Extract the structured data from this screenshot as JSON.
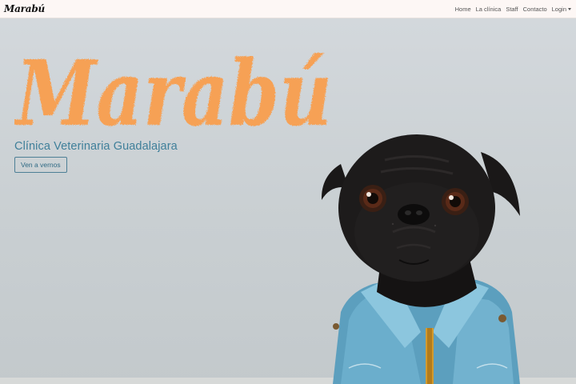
{
  "navbar": {
    "brand": "Marabú",
    "links": [
      "Home",
      "La clínica",
      "Staff",
      "Contacto"
    ],
    "login_label": "Login"
  },
  "hero": {
    "logo_text": "Marabú",
    "subtitle": "Clínica Veterinaria Guadalajara",
    "cta_label": "Ven a vernos"
  },
  "colors": {
    "navbar_bg": "#fdf7f5",
    "logo_orange": "#f6a155",
    "subtitle_blue": "#3f7f9a",
    "hero_bg": "#d3d8dc"
  },
  "icons": {
    "login_dropdown": "caret-down-icon"
  }
}
